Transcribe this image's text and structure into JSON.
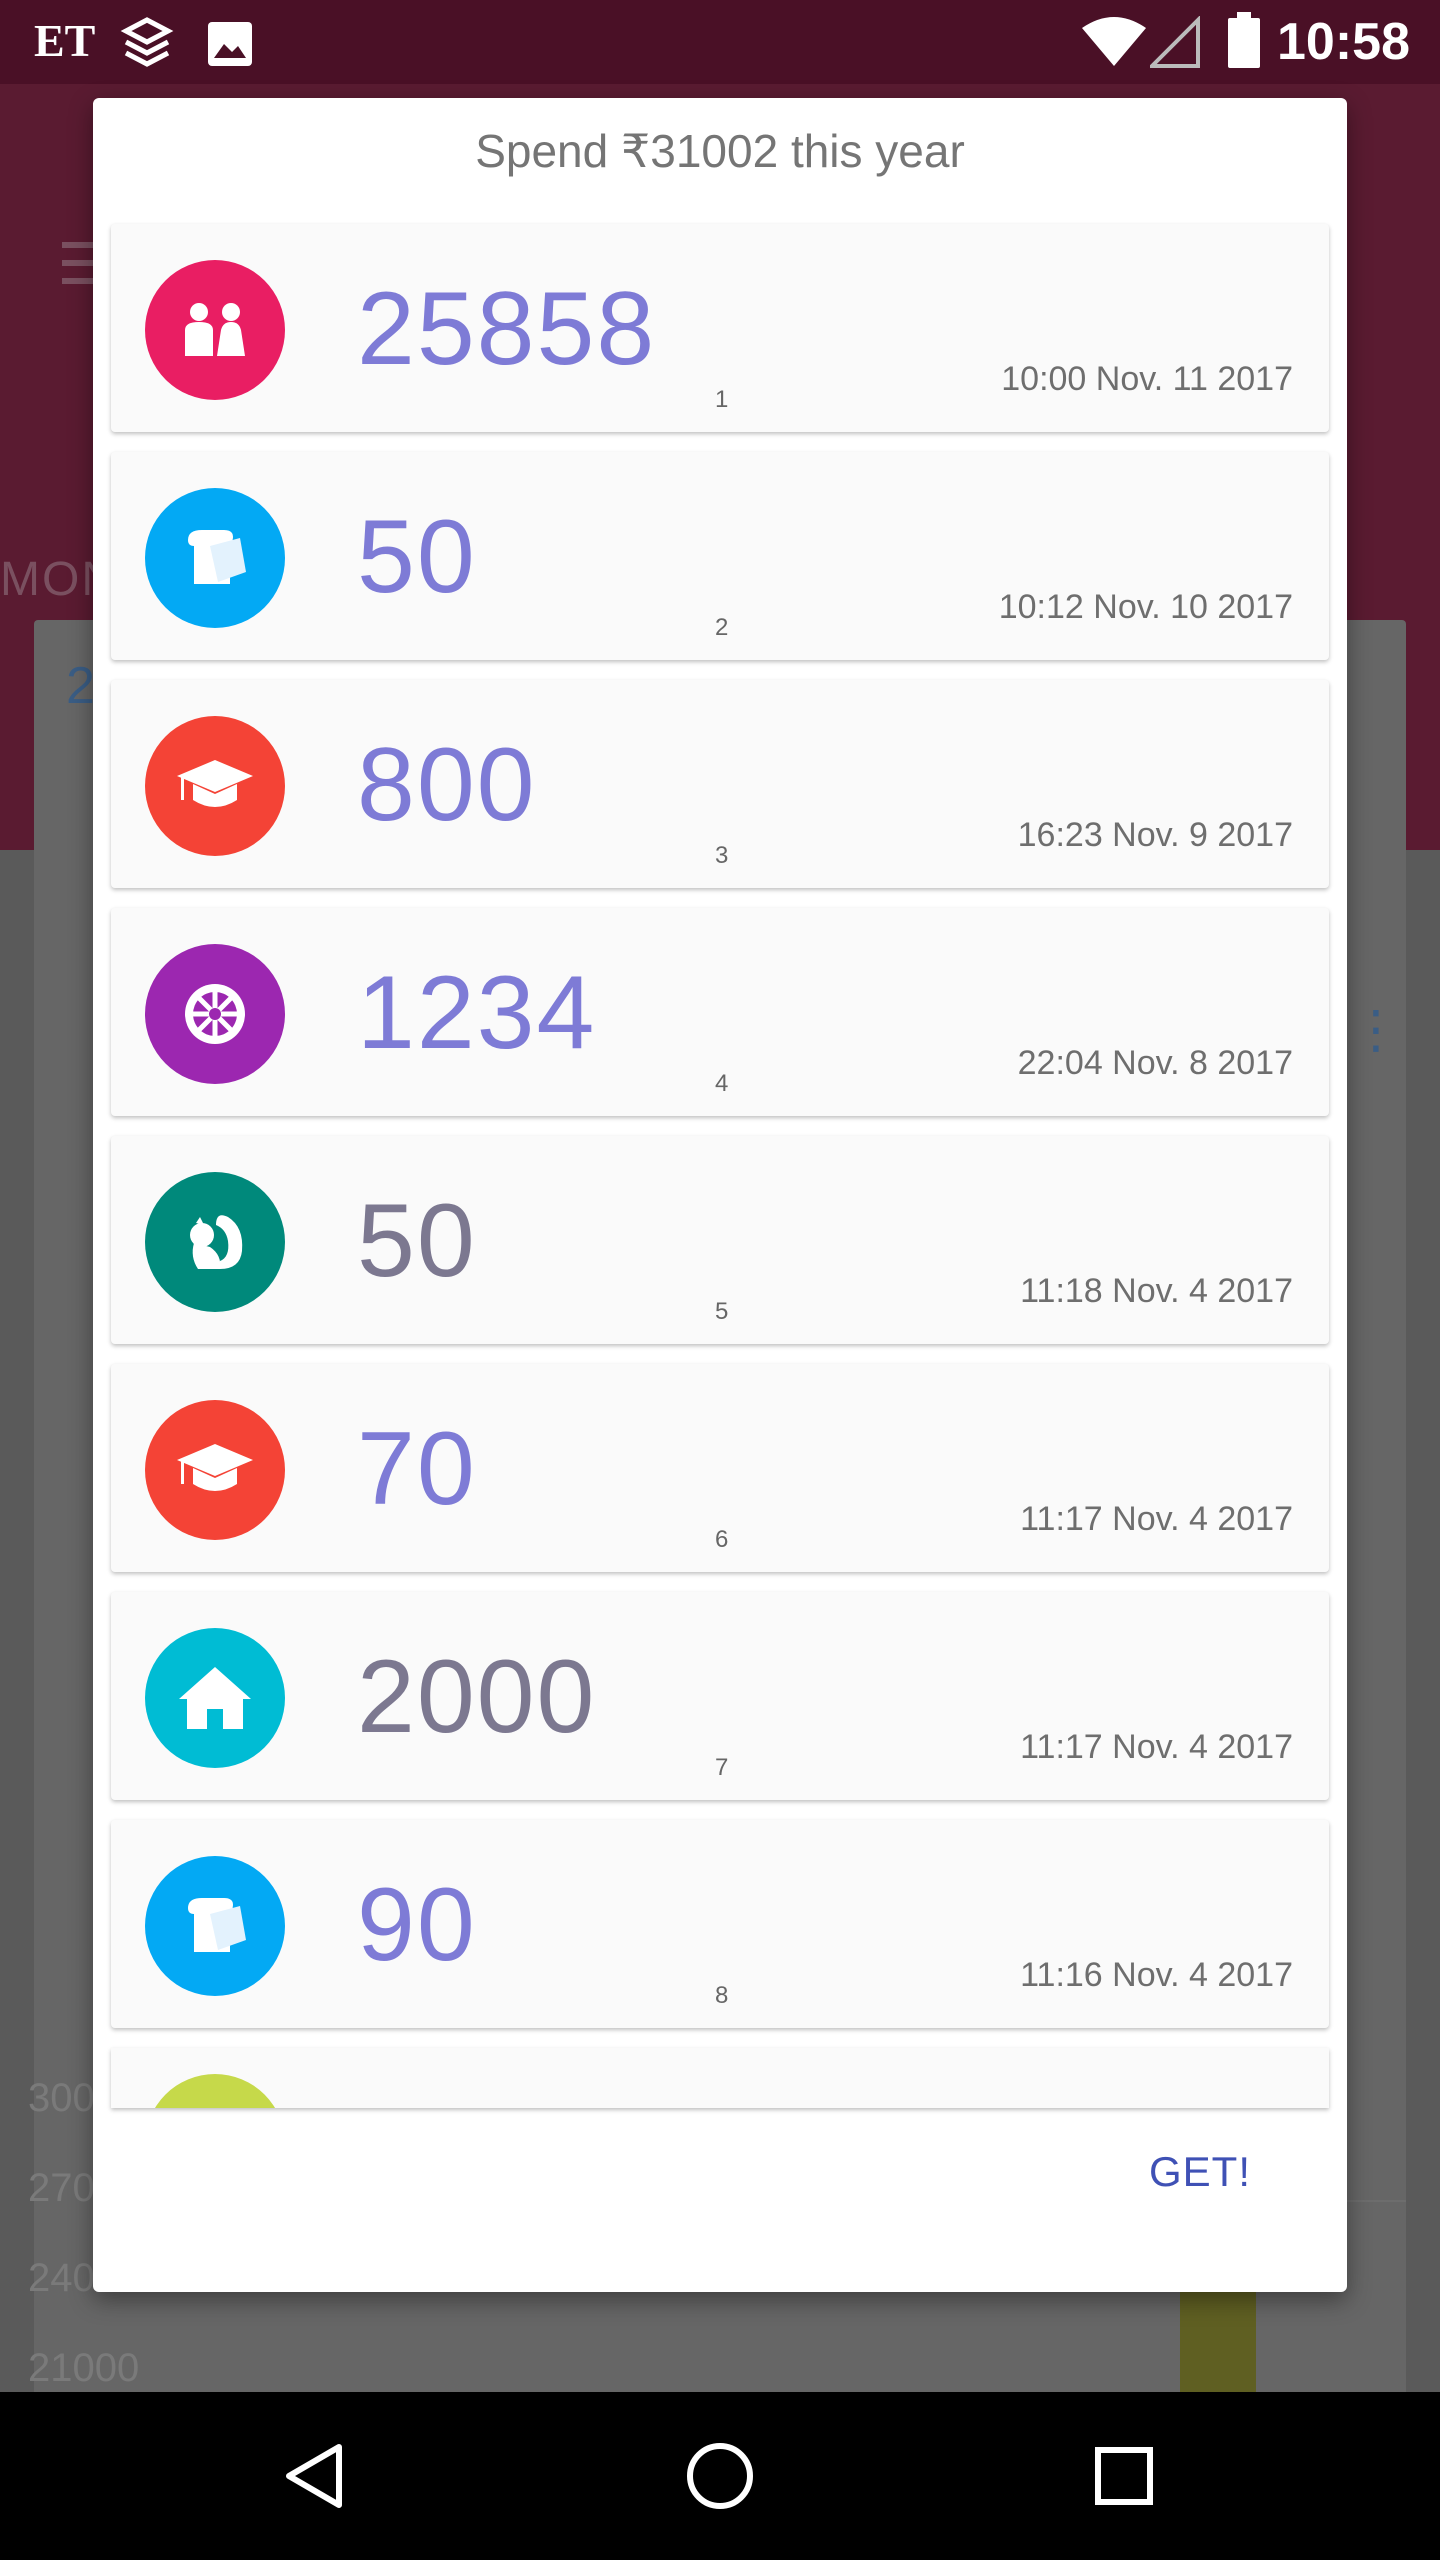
{
  "status_bar": {
    "carrier": "ET",
    "time": "10:58",
    "icons": [
      "layers-app-icon",
      "image-icon",
      "wifi-icon",
      "signal-icon",
      "battery-icon"
    ]
  },
  "background": {
    "left_label": "MONT",
    "small_value": "2",
    "axis_labels": [
      "300",
      "270",
      "240",
      "21000"
    ]
  },
  "dialog": {
    "title": "Spend ₹31002 this year",
    "items": [
      {
        "amount": "25858",
        "index": "1",
        "time": "10:00 Nov. 11 2017",
        "icon": "family-icon",
        "color": "#e91e63"
      },
      {
        "amount": "50",
        "index": "2",
        "time": "10:12 Nov. 10 2017",
        "icon": "bread-icon",
        "color": "#03a9f4"
      },
      {
        "amount": "800",
        "index": "3",
        "time": "16:23 Nov. 9 2017",
        "icon": "graduation-cap-icon",
        "color": "#f44336"
      },
      {
        "amount": "1234",
        "index": "4",
        "time": "22:04 Nov. 8 2017",
        "icon": "film-reel-icon",
        "color": "#9c27b0"
      },
      {
        "amount": "50",
        "index": "5",
        "time": "11:18 Nov. 4 2017",
        "icon": "squirrel-icon",
        "color": "#00897b"
      },
      {
        "amount": "70",
        "index": "6",
        "time": "11:17 Nov. 4 2017",
        "icon": "graduation-cap-icon",
        "color": "#f44336"
      },
      {
        "amount": "2000",
        "index": "7",
        "time": "11:17 Nov. 4 2017",
        "icon": "home-icon",
        "color": "#00bcd4"
      },
      {
        "amount": "90",
        "index": "8",
        "time": "11:16 Nov. 4 2017",
        "icon": "bread-icon",
        "color": "#03a9f4"
      }
    ],
    "get_button": "GET!"
  },
  "nav_bar": {
    "buttons": [
      "back-icon",
      "home-circle-icon",
      "recents-square-icon"
    ]
  }
}
